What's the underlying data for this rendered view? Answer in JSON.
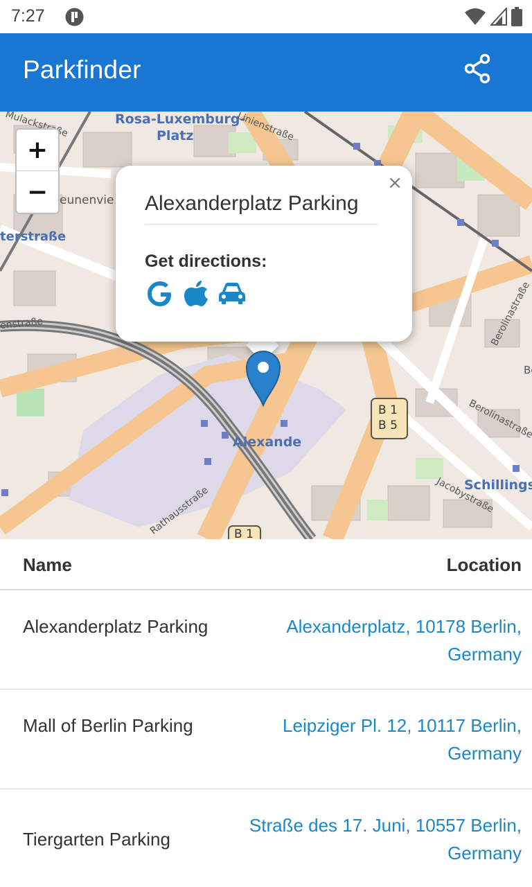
{
  "status": {
    "time": "7:27"
  },
  "app": {
    "title": "Parkfinder",
    "share_icon": "share-icon",
    "bar_color": "#1976d2"
  },
  "map": {
    "zoom_in_label": "+",
    "zoom_out_label": "−",
    "labels": {
      "rosa": "Rosa-Luxemburg-",
      "platz": "Platz",
      "linien": "Linienstraße",
      "mulack": "Mulackstraße",
      "neunenvie": "eunenvie",
      "terstrasse": "terstraße",
      "enstrasse": "enstraße",
      "alexande": "Alexande",
      "b1b5": "B 1\nB 5",
      "b1": "B 1",
      "berolina1": "Berolinastraße",
      "berolina2": "Berolinastraße",
      "schillings": "Schillingst",
      "jacoby": "Jacobystraße",
      "rathaus": "Rathausstraße",
      "b_edge": "Be"
    },
    "popup": {
      "close": "×",
      "title": "Alexanderplatz Parking",
      "subtitle": "Get directions:",
      "icons": [
        "google-icon",
        "apple-icon",
        "car-icon"
      ],
      "accent": "#1a87c9"
    }
  },
  "table": {
    "headers": {
      "name": "Name",
      "location": "Location"
    },
    "rows": [
      {
        "name": "Alexanderplatz Parking",
        "location": "Alexanderplatz, 10178 Berlin, Germany"
      },
      {
        "name": "Mall of Berlin Parking",
        "location": "Leipziger Pl. 12, 10117 Berlin, Germany"
      },
      {
        "name": "Tiergarten Parking",
        "location": "Straße des 17. Juni, 10557 Berlin, Germany"
      }
    ],
    "link_color": "#1a87c9"
  }
}
